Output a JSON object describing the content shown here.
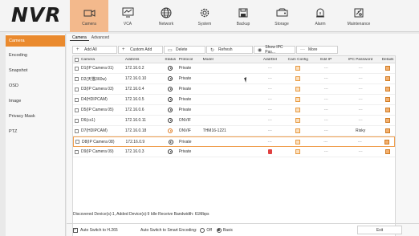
{
  "app": {
    "logo": "NVR"
  },
  "nav": [
    {
      "label": "Camera",
      "icon": "camera-icon",
      "active": true
    },
    {
      "label": "VCA",
      "icon": "vca-icon"
    },
    {
      "label": "Network",
      "icon": "globe-icon"
    },
    {
      "label": "System",
      "icon": "gear-icon"
    },
    {
      "label": "Backup",
      "icon": "backup-icon"
    },
    {
      "label": "Storage",
      "icon": "storage-icon"
    },
    {
      "label": "Alarm",
      "icon": "alarm-icon"
    },
    {
      "label": "Maintenance",
      "icon": "maintenance-icon"
    }
  ],
  "sidebar": [
    {
      "label": "Camera",
      "active": true
    },
    {
      "label": "Encoding"
    },
    {
      "label": "Snapshot"
    },
    {
      "label": "OSD"
    },
    {
      "label": "Image"
    },
    {
      "label": "Privacy Mask"
    },
    {
      "label": "PTZ"
    }
  ],
  "subtabs": [
    {
      "label": "Camera",
      "active": true
    },
    {
      "label": "Advanced"
    }
  ],
  "toolbar": {
    "add_all": "Add All",
    "custom_add": "Custom Add",
    "delete": "Delete",
    "refresh": "Refresh",
    "show_ipc": "Show IPC Pas...",
    "more": "More"
  },
  "table": {
    "headers": [
      "Camera",
      "Address",
      "Status",
      "Protocol",
      "Model",
      "Add/Del",
      "Cam Config",
      "Edit IP",
      "IPC Password",
      "Details"
    ],
    "rows": [
      {
        "camera": "D1(IP Camera 01)",
        "address": "172.16.0.2",
        "protocol": "Private",
        "model": "",
        "add": "---",
        "edit": "---",
        "pwd": "---"
      },
      {
        "camera": "D2(天猫360w)",
        "address": "172.16.0.10",
        "protocol": "Private",
        "model": "",
        "add": "---",
        "edit": "---",
        "pwd": "---"
      },
      {
        "camera": "D3(IP Camera 03)",
        "address": "172.16.0.4",
        "protocol": "Private",
        "model": "",
        "add": "---",
        "edit": "---",
        "pwd": "---"
      },
      {
        "camera": "D4(HDIPCAM)",
        "address": "172.16.0.5",
        "protocol": "Private",
        "model": "",
        "add": "---",
        "edit": "---",
        "pwd": "---"
      },
      {
        "camera": "D5(IP Camera 05)",
        "address": "172.16.0.6",
        "protocol": "Private",
        "model": "",
        "add": "---",
        "edit": "---",
        "pwd": "---"
      },
      {
        "camera": "D6(cs1)",
        "address": "172.16.0.11",
        "protocol": "ONVIF",
        "model": "",
        "add": "---",
        "edit": "---",
        "pwd": "---"
      },
      {
        "camera": "D7(HDIPCAM)",
        "address": "172.16.0.18",
        "protocol": "ONVIF",
        "model": "THM16-1221",
        "add": "---",
        "edit": "---",
        "pwd": "Risky"
      },
      {
        "camera": "D8(IP Camera 08)",
        "address": "172.16.0.9",
        "protocol": "Private",
        "model": "",
        "add": "---",
        "edit": "---",
        "pwd": "---"
      },
      {
        "camera": "D9(IP Camera 09)",
        "address": "172.16.0.3",
        "protocol": "Private",
        "model": "",
        "add": "",
        "edit": "---",
        "pwd": "---"
      }
    ]
  },
  "info": "Discovered Device(s):1, Added Device(s):9 Idle Receive Bandwidth: 61Mbps",
  "bottom": {
    "auto_h265": "Auto Switch to H.265",
    "smart_encoding": "Auto Switch to Smart Encoding:",
    "off": "Off",
    "basic": "Basic",
    "exit": "Exit"
  },
  "colors": {
    "accent": "#ea8a2e",
    "nav_active": "#f3b98c"
  }
}
